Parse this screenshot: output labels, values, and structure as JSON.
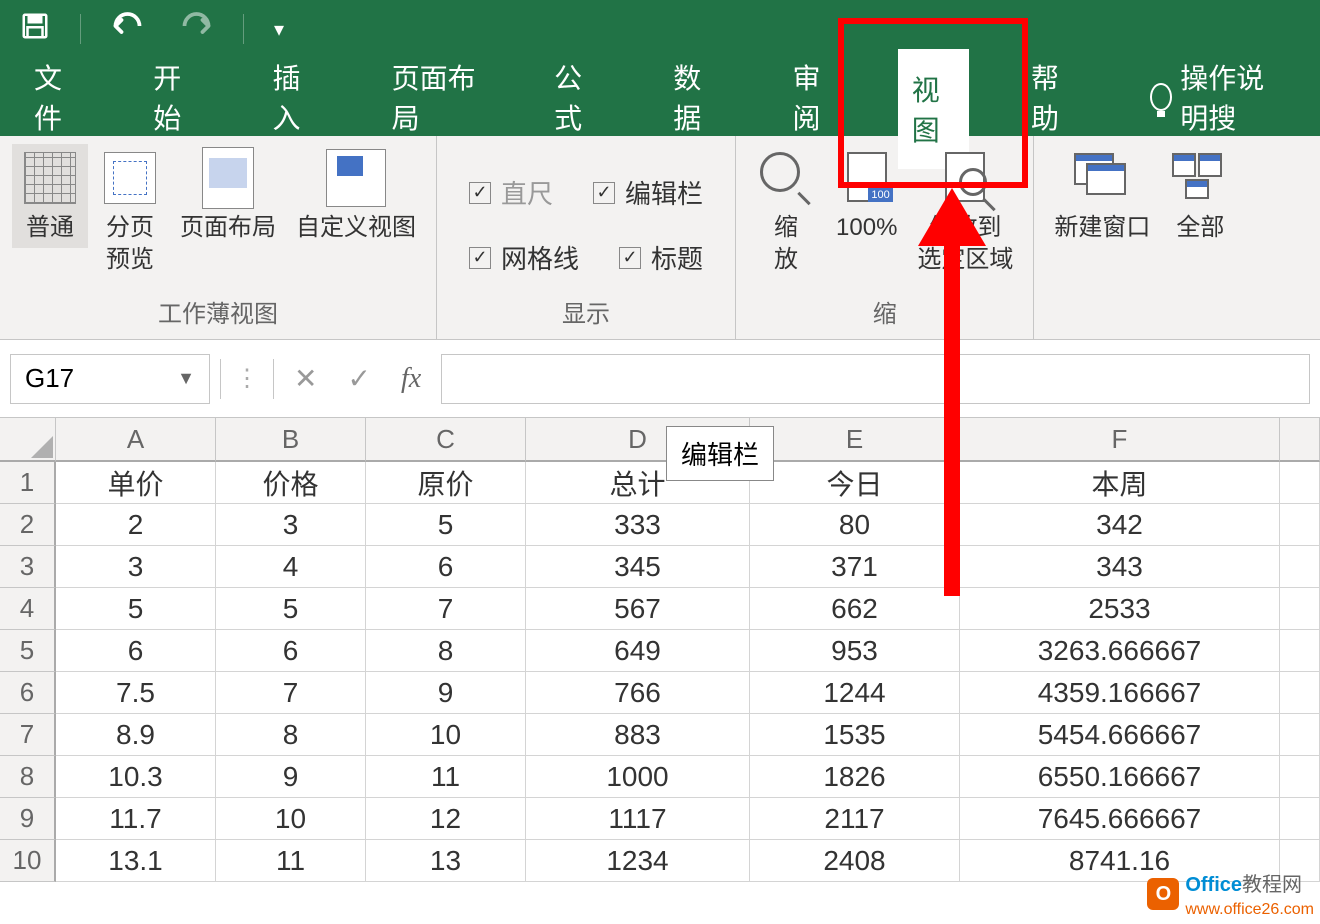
{
  "tabs": [
    "文件",
    "开始",
    "插入",
    "页面布局",
    "公式",
    "数据",
    "审阅",
    "视图",
    "帮助",
    "操作说明搜"
  ],
  "active_tab": "视图",
  "ribbon": {
    "group1_label": "工作薄视图",
    "btn_normal": "普通",
    "btn_pagebreak": "分页\n预览",
    "btn_pagelayout": "页面布局",
    "btn_custom": "自定义视图",
    "group2_label": "显示",
    "chk_ruler": "直尺",
    "chk_formulabar": "编辑栏",
    "chk_gridlines": "网格线",
    "chk_headings": "标题",
    "group3_label": "缩",
    "btn_zoom": "缩\n放",
    "btn_100": "100%",
    "btn_zoomselect": "缩放到\n选定区域",
    "btn_newwindow": "新建窗口",
    "btn_arrange": "全部"
  },
  "namebox": "G17",
  "fx": "fx",
  "tooltip": "编辑栏",
  "columns": [
    "A",
    "B",
    "C",
    "D",
    "E",
    "F"
  ],
  "rows": [
    "1",
    "2",
    "3",
    "4",
    "5",
    "6",
    "7",
    "8",
    "9",
    "10"
  ],
  "cells": [
    [
      "单价",
      "价格",
      "原价",
      "总计",
      "今日",
      "本周"
    ],
    [
      "2",
      "3",
      "5",
      "333",
      "80",
      "342"
    ],
    [
      "3",
      "4",
      "6",
      "345",
      "371",
      "343"
    ],
    [
      "5",
      "5",
      "7",
      "567",
      "662",
      "2533"
    ],
    [
      "6",
      "6",
      "8",
      "649",
      "953",
      "3263.666667"
    ],
    [
      "7.5",
      "7",
      "9",
      "766",
      "1244",
      "4359.166667"
    ],
    [
      "8.9",
      "8",
      "10",
      "883",
      "1535",
      "5454.666667"
    ],
    [
      "10.3",
      "9",
      "11",
      "1000",
      "1826",
      "6550.166667"
    ],
    [
      "11.7",
      "10",
      "12",
      "1117",
      "2117",
      "7645.666667"
    ],
    [
      "13.1",
      "11",
      "13",
      "1234",
      "2408",
      "8741.16"
    ]
  ],
  "watermark": {
    "brand": "Office",
    "suffix": "教程网",
    "url": "www.office26.com",
    "logo": "O"
  }
}
